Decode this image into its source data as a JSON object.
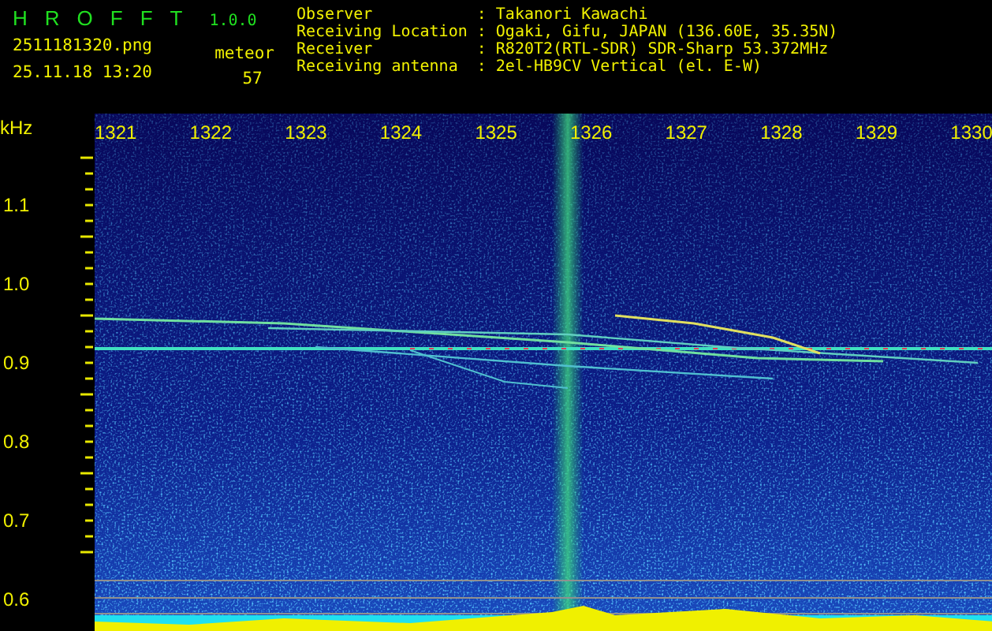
{
  "app": {
    "name": "HROFFT",
    "version": "1.0.0"
  },
  "file": {
    "name": "2511181320.png",
    "timestamp": "25.11.18 13:20"
  },
  "meteor": {
    "label": "meteor",
    "count": "57"
  },
  "station": [
    {
      "label": "Observer",
      "separator": ":",
      "value": "Takanori Kawachi"
    },
    {
      "label": "Receiving Location",
      "separator": ":",
      "value": "Ogaki, Gifu, JAPAN (136.60E, 35.35N)"
    },
    {
      "label": "Receiver",
      "separator": ":",
      "value": "R820T2(RTL-SDR) SDR-Sharp 53.372MHz"
    },
    {
      "label": "Receiving antenna",
      "separator": ":",
      "value": "2el-HB9CV Vertical (el. E-W)"
    }
  ],
  "spectrogram": {
    "unit": "kHz",
    "time_ticks": [
      "1321",
      "1322",
      "1323",
      "1324",
      "1325",
      "1326",
      "1327",
      "1328",
      "1329",
      "1330"
    ],
    "freq_ticks": [
      "1.1",
      "1.0",
      "0.9",
      "0.8",
      "0.7",
      "0.6"
    ]
  }
}
